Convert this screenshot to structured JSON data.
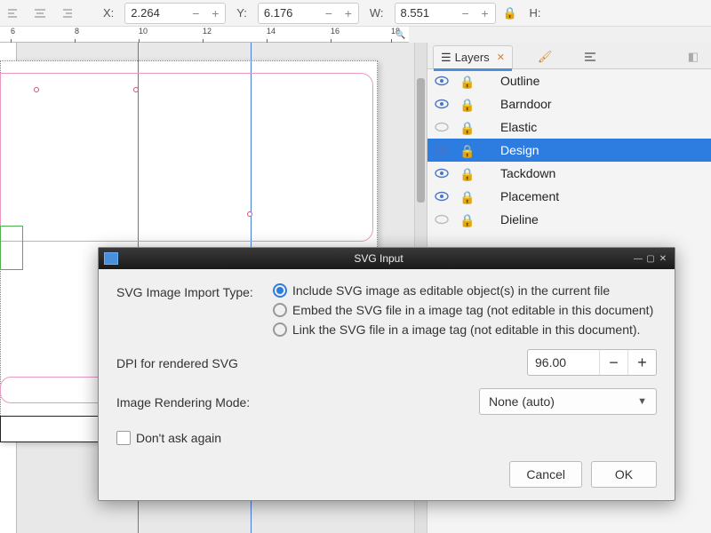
{
  "toolbar": {
    "x_label": "X:",
    "x_value": "2.264",
    "y_label": "Y:",
    "y_value": "6.176",
    "w_label": "W:",
    "w_value": "8.551",
    "h_label": "H:"
  },
  "ruler": {
    "ticks": [
      "6",
      "8",
      "10",
      "12",
      "14",
      "16",
      "18"
    ]
  },
  "panels": {
    "tab_layers": "Layers",
    "layers": [
      {
        "name": "Outline",
        "visible": true
      },
      {
        "name": "Barndoor",
        "visible": true
      },
      {
        "name": "Elastic",
        "visible": false
      },
      {
        "name": "Design",
        "visible": true,
        "selected": true
      },
      {
        "name": "Tackdown",
        "visible": true
      },
      {
        "name": "Placement",
        "visible": true
      },
      {
        "name": "Dieline",
        "visible": false
      }
    ]
  },
  "dialog": {
    "title": "SVG Input",
    "import_label": "SVG Image Import Type:",
    "opt_include": "Include SVG image as editable object(s) in the current file",
    "opt_embed": "Embed the SVG file in a image tag (not editable in this document)",
    "opt_link": "Link the SVG file in a image tag (not editable in this document).",
    "dpi_label": "DPI for rendered SVG",
    "dpi_value": "96.00",
    "render_label": "Image Rendering Mode:",
    "render_value": "None (auto)",
    "dont_ask": "Don't ask again",
    "cancel": "Cancel",
    "ok": "OK"
  }
}
